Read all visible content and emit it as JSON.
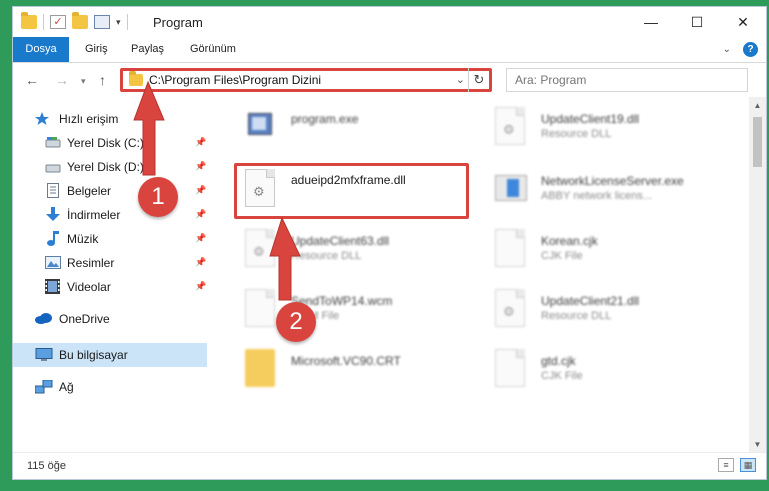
{
  "window": {
    "title": "Program",
    "minimize": "—",
    "maximize": "☐",
    "close": "✕"
  },
  "ribbon": {
    "tabs": [
      "Dosya",
      "Giriş",
      "Paylaş",
      "Görünüm"
    ],
    "expand": "⌄",
    "help": "?"
  },
  "nav": {
    "back": "←",
    "forward": "→",
    "recent": "▾",
    "up": "↑"
  },
  "address": {
    "path": "C:\\Program Files\\Program Dizini",
    "dropdown": "⌄",
    "refresh": "↻"
  },
  "search": {
    "placeholder": "Ara: Program"
  },
  "sidebar": {
    "items": [
      {
        "label": "Hızlı erişim",
        "icon": "star-icon"
      },
      {
        "label": "Yerel Disk (C:)",
        "icon": "drive-icon",
        "pinned": true
      },
      {
        "label": "Yerel Disk (D:)",
        "icon": "drive-icon",
        "pinned": true
      },
      {
        "label": "Belgeler",
        "icon": "documents-icon",
        "pinned": true
      },
      {
        "label": "İndirmeler",
        "icon": "download-icon",
        "pinned": true
      },
      {
        "label": "Müzik",
        "icon": "music-icon",
        "pinned": true
      },
      {
        "label": "Resimler",
        "icon": "pictures-icon",
        "pinned": true
      },
      {
        "label": "Videolar",
        "icon": "video-icon",
        "pinned": true
      },
      {
        "label": "OneDrive",
        "icon": "cloud-icon"
      },
      {
        "label": "Bu bilgisayar",
        "icon": "computer-icon",
        "selected": true
      },
      {
        "label": "Ağ",
        "icon": "network-icon"
      }
    ]
  },
  "files": [
    {
      "name": "program.exe",
      "type": "",
      "icon": "exe-icon"
    },
    {
      "name": "UpdateClient19.dll",
      "type": "Resource DLL",
      "icon": "dll-icon"
    },
    {
      "name": "adueipd2mfxframe.dll",
      "type": "",
      "icon": "dll-icon",
      "highlighted": true
    },
    {
      "name": "NetworkLicenseServer.exe",
      "type": "ABBY network licens...",
      "icon": "app-exe-icon"
    },
    {
      "name": "UpdateClient63.dll",
      "type": "Resource DLL",
      "icon": "dll-icon"
    },
    {
      "name": "Korean.cjk",
      "type": "CJK File",
      "icon": "file-icon"
    },
    {
      "name": "SendToWP14.wcm",
      "type": "WCM File",
      "icon": "file-icon"
    },
    {
      "name": "UpdateClient21.dll",
      "type": "Resource DLL",
      "icon": "dll-icon"
    },
    {
      "name": "Microsoft.VC90.CRT",
      "type": "",
      "icon": "folder-icon"
    },
    {
      "name": "gtd.cjk",
      "type": "CJK File",
      "icon": "file-icon"
    }
  ],
  "status": {
    "count": "115 öğe"
  },
  "callouts": [
    "1",
    "2"
  ],
  "colors": {
    "accent": "#1979ca",
    "highlight": "#d9443e",
    "selected": "#cce4f7",
    "background": "#2e9b5a"
  }
}
